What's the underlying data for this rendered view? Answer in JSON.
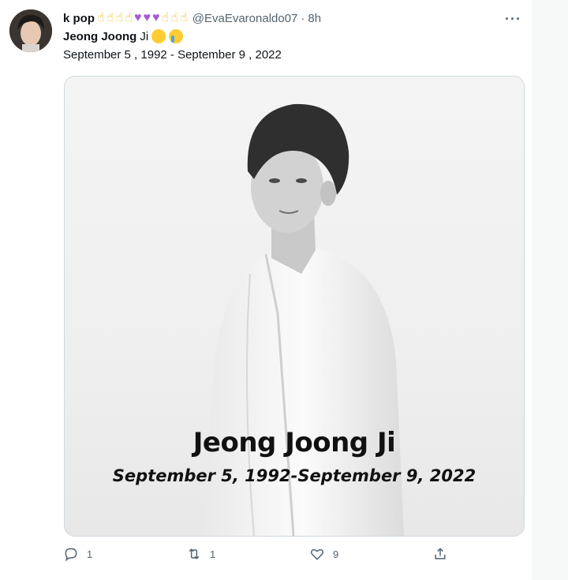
{
  "tweet": {
    "display_name": "k pop",
    "name_emojis": [
      "hand-emoji",
      "hand-emoji",
      "hand-emoji",
      "hand-emoji",
      "purple-heart-emoji",
      "purple-heart-emoji",
      "purple-heart-emoji",
      "hand-emoji",
      "hand-emoji",
      "hand-emoji"
    ],
    "handle": "@EvaEvaronaldo07",
    "separator": "·",
    "time": "8h",
    "more_label": "···",
    "text_line1_bold": "Jeong Joong",
    "text_line1_rest": "Ji",
    "text_line2": "September 5 , 1992 - September 9 , 2022",
    "media": {
      "caption_title": "Jeong Joong Ji",
      "caption_dates": "September 5, 1992-September 9, 2022"
    },
    "actions": {
      "reply_count": "1",
      "retweet_count": "1",
      "like_count": "9"
    }
  },
  "colors": {
    "text": "#0f1419",
    "secondary": "#536471",
    "border": "#cfd9de"
  }
}
